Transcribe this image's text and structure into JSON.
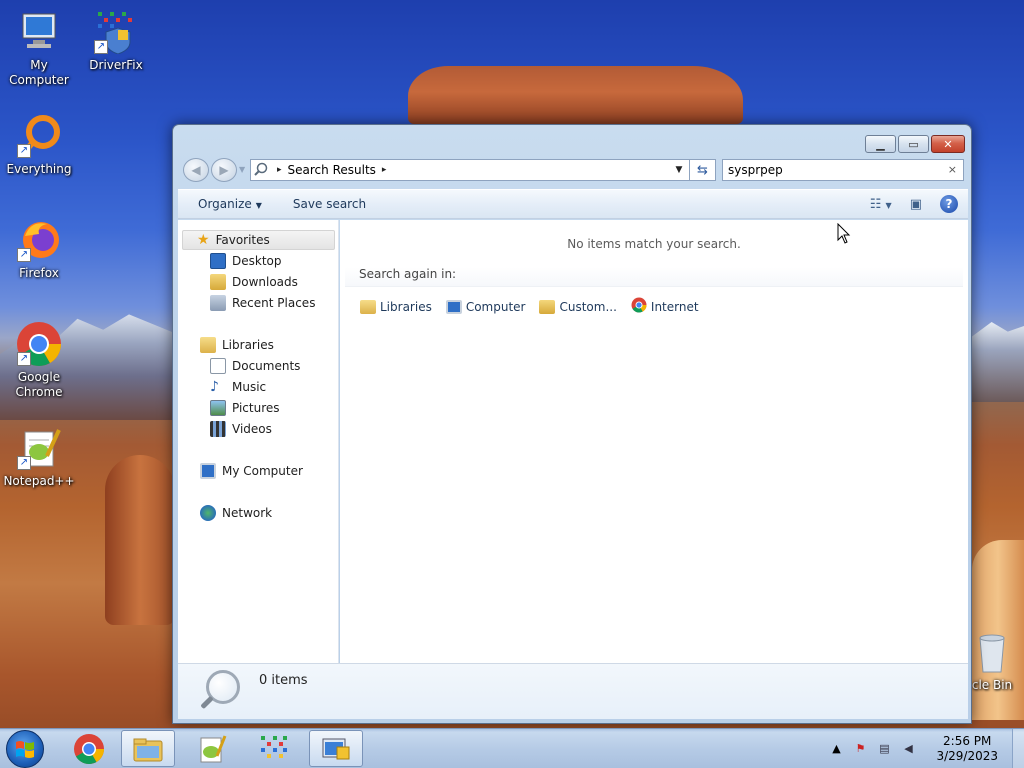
{
  "desktop": {
    "icons": [
      {
        "label": "My Computer"
      },
      {
        "label": "DriverFix"
      },
      {
        "label": "Everything"
      },
      {
        "label": "Firefox"
      },
      {
        "label": "Google Chrome"
      },
      {
        "label": "Notepad++"
      },
      {
        "label": "cle Bin"
      }
    ]
  },
  "window": {
    "address": {
      "path_label": "Search Results",
      "sep": "▸"
    },
    "search": {
      "value": "sysprpep",
      "clear": "×"
    },
    "toolbar": {
      "organize_label": "Organize",
      "save_search_label": "Save search",
      "help_label": "?"
    },
    "nav_pane": {
      "favorites": "Favorites",
      "desktop": "Desktop",
      "downloads": "Downloads",
      "recent": "Recent Places",
      "libraries": "Libraries",
      "documents": "Documents",
      "music": "Music",
      "pictures": "Pictures",
      "videos": "Videos",
      "my_computer": "My Computer",
      "network": "Network"
    },
    "content": {
      "no_items": "No items match your search.",
      "search_again_label": "Search again in:",
      "search_again": [
        {
          "label": "Libraries"
        },
        {
          "label": "Computer"
        },
        {
          "label": "Custom..."
        },
        {
          "label": "Internet"
        }
      ]
    },
    "details": {
      "count_text": "0 items"
    }
  },
  "taskbar": {
    "clock": {
      "time": "2:56 PM",
      "date": "3/29/2023"
    }
  },
  "colors": {
    "window_frame": "#bcd2ea",
    "link_text": "#1e395b",
    "close_button": "#c2412b"
  }
}
